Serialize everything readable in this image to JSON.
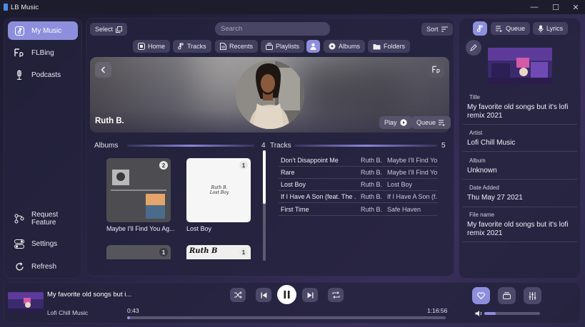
{
  "window": {
    "title": "LB Music",
    "minimize": "—",
    "maximize": "☐",
    "close": "✕"
  },
  "sidebar": {
    "items": [
      {
        "label": "My Music",
        "icon": "music-note-icon",
        "active": true
      },
      {
        "label": "FLBing",
        "icon": "flbing-icon"
      },
      {
        "label": "Podcasts",
        "icon": "microphone-icon"
      }
    ],
    "bottom": [
      {
        "label": "Request Feature",
        "icon": "branch-icon"
      },
      {
        "label": "Settings",
        "icon": "toggle-icon"
      },
      {
        "label": "Refresh",
        "icon": "refresh-icon"
      }
    ]
  },
  "toolbar": {
    "select_label": "Select",
    "search_placeholder": "Search",
    "sort_label": "Sort",
    "tabs": [
      {
        "label": "Home"
      },
      {
        "label": "Tracks"
      },
      {
        "label": "Recents"
      },
      {
        "label": "Playlists"
      },
      {
        "label": ""
      },
      {
        "label": "Albums"
      },
      {
        "label": "Folders"
      }
    ]
  },
  "artist": {
    "name": "Ruth B.",
    "play_label": "Play",
    "queue_label": "Queue"
  },
  "albums": {
    "title": "Albums",
    "count": "4",
    "items": [
      {
        "title": "Maybe I'll Find You Ag...",
        "badge": "2"
      },
      {
        "title": "Lost Boy",
        "badge": "1",
        "cover_text": "Ruth B. Lost Boy"
      },
      {
        "title": "",
        "badge": "1"
      },
      {
        "title": "",
        "badge": "1",
        "cover_text": "Ruth B"
      }
    ]
  },
  "tracks": {
    "title": "Tracks",
    "count": "5",
    "rows": [
      {
        "title": "Don't Disappoint Me",
        "artist": "Ruth B.",
        "album": "Maybe I'll Find Yo..."
      },
      {
        "title": "Rare",
        "artist": "Ruth B.",
        "album": "Maybe I'll Find Yo..."
      },
      {
        "title": "Lost Boy",
        "artist": "Ruth B.",
        "album": "Lost Boy"
      },
      {
        "title": "If I Have A Son (feat. The ...",
        "artist": "Ruth B.",
        "album": "If I Have A Son (f..."
      },
      {
        "title": "First Time",
        "artist": "Ruth B.",
        "album": "Safe Haven"
      }
    ]
  },
  "right_panel": {
    "queue_label": "Queue",
    "lyrics_label": "Lyrics",
    "fields": [
      {
        "label": "Title",
        "value": "My favorite old songs but it's lofi remix 2021"
      },
      {
        "label": "Artist",
        "value": "Lofi Chill Music"
      },
      {
        "label": "Album",
        "value": "Unknown"
      },
      {
        "label": "Date Added",
        "value": "Thu May 27 2021"
      },
      {
        "label": "File name",
        "value": "My favorite old songs but it's lofi remix 2021"
      }
    ]
  },
  "player": {
    "title": "My favorite old songs but i...",
    "artist": "Lofi Chill Music",
    "elapsed": "0:43",
    "duration": "1:16:56",
    "progress": 0.01,
    "volume": 0.2
  },
  "colors": {
    "accent": "#8d8fdd",
    "panel": "#24223c"
  }
}
